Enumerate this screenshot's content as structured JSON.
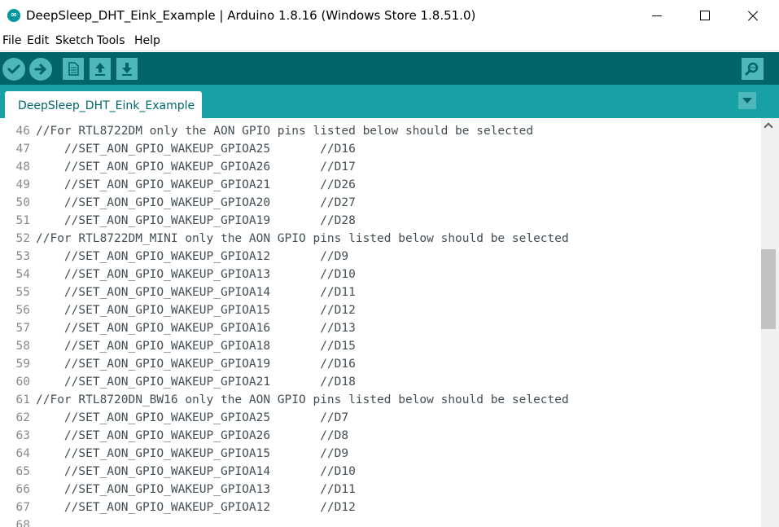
{
  "window": {
    "title": "DeepSleep_DHT_Eink_Example | Arduino 1.8.16 (Windows Store 1.8.51.0)",
    "app_icon": "arduino-infinity-icon",
    "app_icon_glyph": "∞"
  },
  "menu": {
    "items": [
      "File",
      "Edit",
      "Sketch",
      "Tools",
      "Help"
    ]
  },
  "toolbar": {
    "buttons": [
      "verify-icon",
      "upload-icon",
      "new-icon",
      "open-icon",
      "save-icon"
    ],
    "right_button": "serial-monitor-icon"
  },
  "tabs": [
    {
      "label": "DeepSleep_DHT_Eink_Example",
      "active": true
    }
  ],
  "editor": {
    "lines": [
      {
        "no": "46",
        "code": "//For RTL8722DM only the AON GPIO pins listed below should be selected"
      },
      {
        "no": "47",
        "code": "    //SET_AON_GPIO_WAKEUP_GPIOA25       //D16"
      },
      {
        "no": "48",
        "code": "    //SET_AON_GPIO_WAKEUP_GPIOA26       //D17"
      },
      {
        "no": "49",
        "code": "    //SET_AON_GPIO_WAKEUP_GPIOA21       //D26"
      },
      {
        "no": "50",
        "code": "    //SET_AON_GPIO_WAKEUP_GPIOA20       //D27"
      },
      {
        "no": "51",
        "code": "    //SET_AON_GPIO_WAKEUP_GPIOA19       //D28"
      },
      {
        "no": "52",
        "code": "//For RTL8722DM_MINI only the AON GPIO pins listed below should be selected"
      },
      {
        "no": "53",
        "code": "    //SET_AON_GPIO_WAKEUP_GPIOA12       //D9"
      },
      {
        "no": "54",
        "code": "    //SET_AON_GPIO_WAKEUP_GPIOA13       //D10"
      },
      {
        "no": "55",
        "code": "    //SET_AON_GPIO_WAKEUP_GPIOA14       //D11"
      },
      {
        "no": "56",
        "code": "    //SET_AON_GPIO_WAKEUP_GPIOA15       //D12"
      },
      {
        "no": "57",
        "code": "    //SET_AON_GPIO_WAKEUP_GPIOA16       //D13"
      },
      {
        "no": "58",
        "code": "    //SET_AON_GPIO_WAKEUP_GPIOA18       //D15"
      },
      {
        "no": "59",
        "code": "    //SET_AON_GPIO_WAKEUP_GPIOA19       //D16"
      },
      {
        "no": "60",
        "code": "    //SET_AON_GPIO_WAKEUP_GPIOA21       //D18"
      },
      {
        "no": "61",
        "code": "//For RTL8720DN_BW16 only the AON GPIO pins listed below should be selected"
      },
      {
        "no": "62",
        "code": "    //SET_AON_GPIO_WAKEUP_GPIOA25       //D7"
      },
      {
        "no": "63",
        "code": "    //SET_AON_GPIO_WAKEUP_GPIOA26       //D8"
      },
      {
        "no": "64",
        "code": "    //SET_AON_GPIO_WAKEUP_GPIOA15       //D9"
      },
      {
        "no": "65",
        "code": "    //SET_AON_GPIO_WAKEUP_GPIOA14       //D10"
      },
      {
        "no": "66",
        "code": "    //SET_AON_GPIO_WAKEUP_GPIOA13       //D11"
      },
      {
        "no": "67",
        "code": "    //SET_AON_GPIO_WAKEUP_GPIOA12       //D12"
      },
      {
        "no": "68",
        "code": ""
      }
    ]
  },
  "colors": {
    "toolbar_bg": "#006468",
    "tabbar_bg": "#17a1a5",
    "button_bg": "#4db7bb",
    "tab_text": "#00676b",
    "code_text": "#434f54",
    "line_number": "#8a8a8a"
  }
}
